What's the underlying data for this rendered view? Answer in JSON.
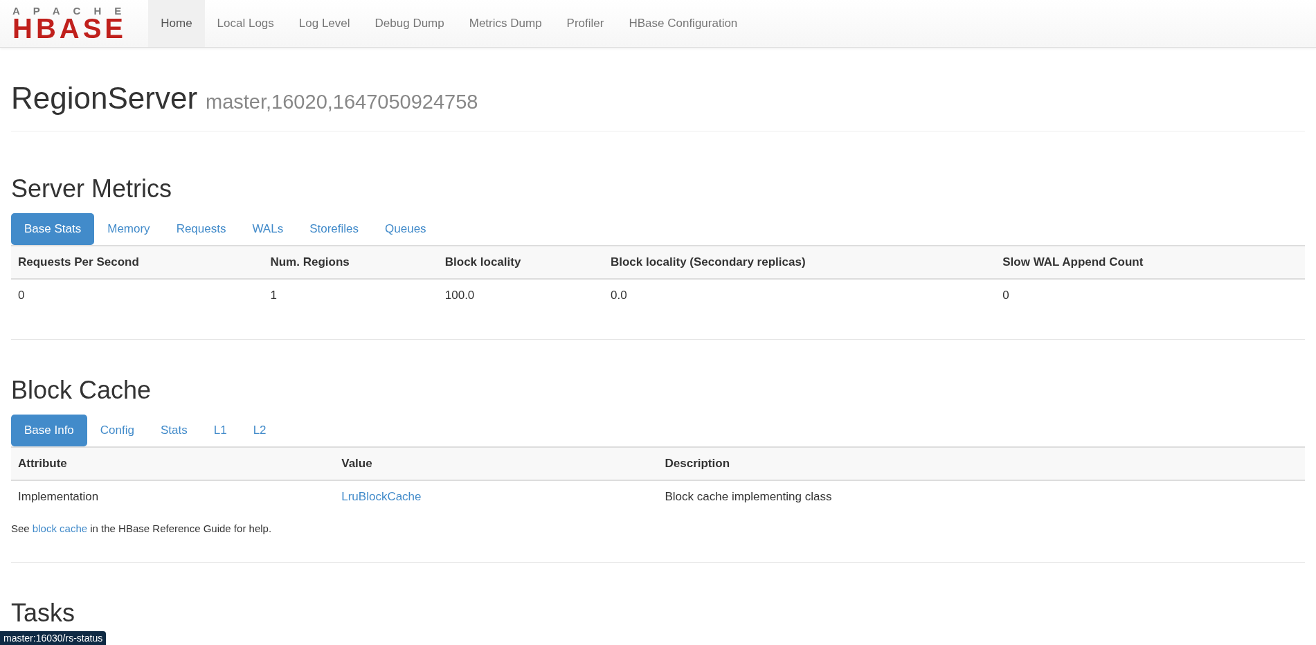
{
  "navbar": {
    "logo": {
      "top": "APACHE",
      "main": "HBASE"
    },
    "items": [
      {
        "label": "Home",
        "selected": true
      },
      {
        "label": "Local Logs",
        "selected": false
      },
      {
        "label": "Log Level",
        "selected": false
      },
      {
        "label": "Debug Dump",
        "selected": false
      },
      {
        "label": "Metrics Dump",
        "selected": false
      },
      {
        "label": "Profiler",
        "selected": false
      },
      {
        "label": "HBase Configuration",
        "selected": false
      }
    ]
  },
  "page_header": {
    "title": "RegionServer",
    "subtitle": "master,16020,1647050924758"
  },
  "sections": [
    {
      "title": "Server Metrics",
      "tabs": [
        {
          "label": "Base Stats",
          "selected": true
        },
        {
          "label": "Memory",
          "selected": false
        },
        {
          "label": "Requests",
          "selected": false
        },
        {
          "label": "WALs",
          "selected": false
        },
        {
          "label": "Storefiles",
          "selected": false
        },
        {
          "label": "Queues",
          "selected": false
        }
      ],
      "table": {
        "columns": [
          "Requests Per Second",
          "Num. Regions",
          "Block locality",
          "Block locality (Secondary replicas)",
          "Slow WAL Append Count"
        ],
        "rows": [
          [
            {
              "kind": "text",
              "text": "0"
            },
            {
              "kind": "text",
              "text": "1"
            },
            {
              "kind": "text",
              "text": "100.0"
            },
            {
              "kind": "text",
              "text": "0.0"
            },
            {
              "kind": "text",
              "text": "0"
            }
          ]
        ]
      }
    },
    {
      "title": "Block Cache",
      "tabs": [
        {
          "label": "Base Info",
          "selected": true
        },
        {
          "label": "Config",
          "selected": false
        },
        {
          "label": "Stats",
          "selected": false
        },
        {
          "label": "L1",
          "selected": false
        },
        {
          "label": "L2",
          "selected": false
        }
      ],
      "table": {
        "columns": [
          "Attribute",
          "Value",
          "Description"
        ],
        "rows": [
          [
            {
              "kind": "text",
              "text": "Implementation"
            },
            {
              "kind": "link",
              "text": "LruBlockCache"
            },
            {
              "kind": "text",
              "text": "Block cache implementing class"
            }
          ]
        ]
      },
      "note": {
        "before": "See ",
        "link": "block cache",
        "after": " in the HBase Reference Guide for help."
      }
    },
    {
      "title": "Tasks"
    }
  ],
  "status_url": "master:16030/rs-status"
}
